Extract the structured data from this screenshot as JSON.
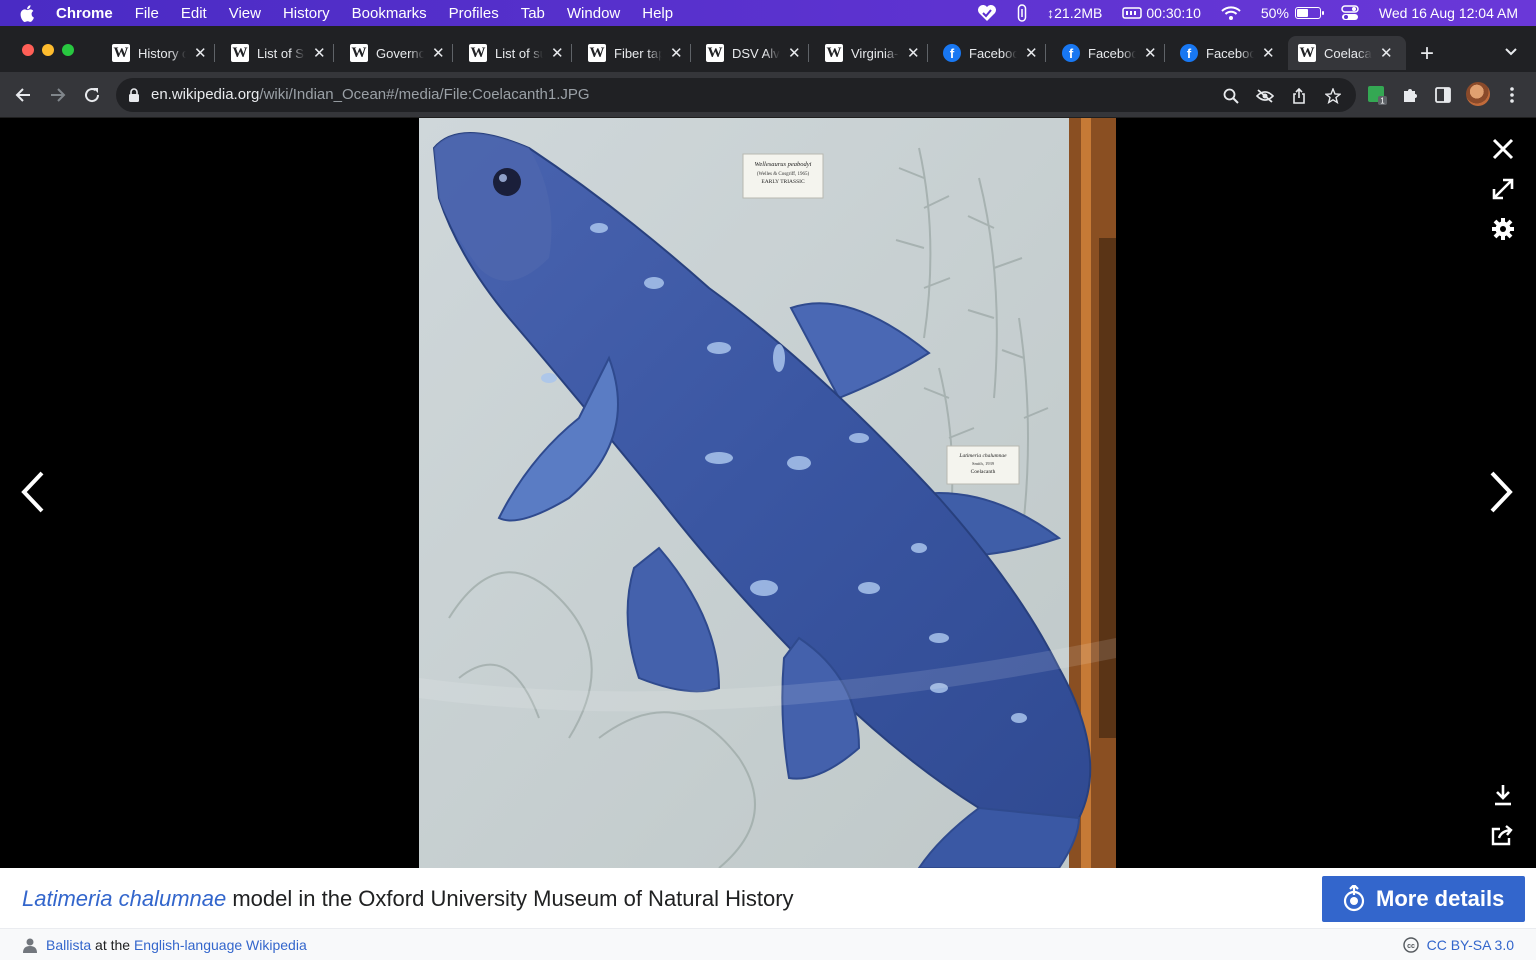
{
  "menubar": {
    "app": "Chrome",
    "items": [
      "File",
      "Edit",
      "View",
      "History",
      "Bookmarks",
      "Profiles",
      "Tab",
      "Window",
      "Help"
    ],
    "net_speed": "↕21.2MB",
    "timer": "00:30:10",
    "battery_percent": "50%",
    "battery_level": 0.5,
    "clock": "Wed 16 Aug  12:04 AM"
  },
  "tabs": [
    {
      "title": "History of the Indian Ocean",
      "favicon": "wikipedia-icon"
    },
    {
      "title": "List of Seas",
      "favicon": "wikipedia-icon"
    },
    {
      "title": "Governor",
      "favicon": "wikipedia-icon"
    },
    {
      "title": "List of submarine",
      "favicon": "wikipedia-icon"
    },
    {
      "title": "Fiber tapping",
      "favicon": "wikipedia-icon"
    },
    {
      "title": "DSV Alvin",
      "favicon": "wikipedia-icon"
    },
    {
      "title": "Virginia-class",
      "favicon": "wikipedia-icon"
    },
    {
      "title": "Facebook",
      "favicon": "facebook-icon"
    },
    {
      "title": "Facebook",
      "favicon": "facebook-icon"
    },
    {
      "title": "Facebook",
      "favicon": "facebook-icon"
    },
    {
      "title": "Coelacanth",
      "favicon": "wikipedia-icon",
      "active": true
    }
  ],
  "address": {
    "host": "en.wikipedia.org",
    "path": "/wiki/Indian_Ocean#/media/File:Coelacanth1.JPG"
  },
  "photo": {
    "label_top_title": "Wellesaurus peabodyi",
    "label_top_sub": "(Welles & Cosgriff, 1965)",
    "label_top_period": "EARLY TRIASSIC",
    "label_mid_title": "Latimeria chalumnae",
    "label_mid_sub": "Smith, 1939",
    "label_mid_common": "Coelacanth"
  },
  "caption": {
    "scientific_name": "Latimeria chalumnae",
    "rest": " model in the Oxford University Museum of Natural History",
    "more_details": "More details"
  },
  "credit": {
    "author": "Ballista",
    "middle": " at the ",
    "source": "English-language Wikipedia",
    "license": "CC BY-SA 3.0"
  },
  "colors": {
    "menubar": "#5b2fd0",
    "accent_link": "#3366cc",
    "fish": "#3f5ea8"
  }
}
